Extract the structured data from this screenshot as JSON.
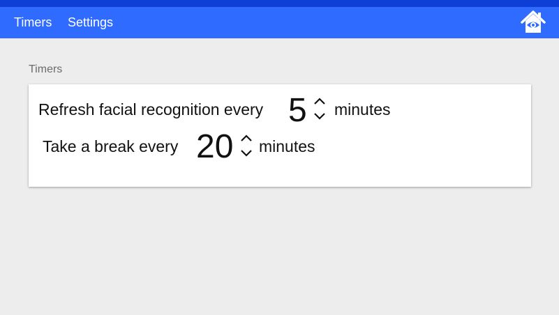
{
  "appbar": {
    "tabs": [
      {
        "label": "Timers"
      },
      {
        "label": "Settings"
      }
    ],
    "home_icon": "home-eye-icon",
    "color": "#2f6bff",
    "strip_color": "#0d3fd6"
  },
  "section": {
    "title": "Timers"
  },
  "timers": [
    {
      "prefix": "Refresh facial recognition every",
      "value": "5",
      "unit": "minutes"
    },
    {
      "prefix": "Take a break every",
      "value": "20",
      "unit": "minutes"
    }
  ]
}
